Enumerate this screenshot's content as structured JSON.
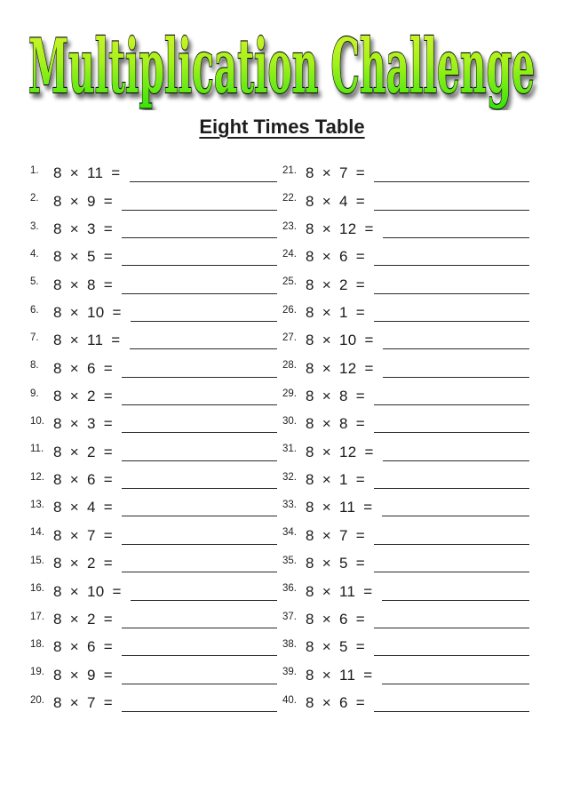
{
  "worksheet": {
    "title": "Multiplication Challenge",
    "subtitle": "Eight Times Table",
    "colors": {
      "title_fill_top": "#7cf020",
      "title_fill_mid": "#c8f52a",
      "title_fill_bottom": "#3fe60a",
      "title_outline": "#111111"
    },
    "left_column": [
      {
        "number": "1.",
        "expression": "8 × 11 ="
      },
      {
        "number": "2.",
        "expression": "8 × 9 ="
      },
      {
        "number": "3.",
        "expression": "8 × 3 ="
      },
      {
        "number": "4.",
        "expression": "8 × 5 ="
      },
      {
        "number": "5.",
        "expression": "8 × 8 ="
      },
      {
        "number": "6.",
        "expression": "8 × 10 ="
      },
      {
        "number": "7.",
        "expression": "8 × 11 ="
      },
      {
        "number": "8.",
        "expression": "8 × 6 ="
      },
      {
        "number": "9.",
        "expression": "8 × 2 ="
      },
      {
        "number": "10.",
        "expression": "8 × 3 ="
      },
      {
        "number": "11.",
        "expression": "8 × 2 ="
      },
      {
        "number": "12.",
        "expression": "8 × 6 ="
      },
      {
        "number": "13.",
        "expression": "8 × 4 ="
      },
      {
        "number": "14.",
        "expression": "8 × 7 ="
      },
      {
        "number": "15.",
        "expression": "8 × 2 ="
      },
      {
        "number": "16.",
        "expression": "8 × 10 ="
      },
      {
        "number": "17.",
        "expression": "8 × 2 ="
      },
      {
        "number": "18.",
        "expression": "8 × 6 ="
      },
      {
        "number": "19.",
        "expression": "8 × 9 ="
      },
      {
        "number": "20.",
        "expression": "8 × 7 ="
      }
    ],
    "right_column": [
      {
        "number": "21.",
        "expression": "8 × 7 ="
      },
      {
        "number": "22.",
        "expression": "8 × 4 ="
      },
      {
        "number": "23.",
        "expression": "8 × 12 ="
      },
      {
        "number": "24.",
        "expression": "8 × 6 ="
      },
      {
        "number": "25.",
        "expression": "8 × 2 ="
      },
      {
        "number": "26.",
        "expression": "8 × 1 ="
      },
      {
        "number": "27.",
        "expression": "8 × 10 ="
      },
      {
        "number": "28.",
        "expression": "8 × 12 ="
      },
      {
        "number": "29.",
        "expression": "8 × 8 ="
      },
      {
        "number": "30.",
        "expression": "8 × 8 ="
      },
      {
        "number": "31.",
        "expression": "8 × 12 ="
      },
      {
        "number": "32.",
        "expression": "8 × 1 ="
      },
      {
        "number": "33.",
        "expression": "8 × 11 ="
      },
      {
        "number": "34.",
        "expression": "8 × 7 ="
      },
      {
        "number": "35.",
        "expression": "8 × 5 ="
      },
      {
        "number": "36.",
        "expression": "8 × 11 ="
      },
      {
        "number": "37.",
        "expression": "8 × 6 ="
      },
      {
        "number": "38.",
        "expression": "8 × 5 ="
      },
      {
        "number": "39.",
        "expression": "8 × 11 ="
      },
      {
        "number": "40.",
        "expression": "8 × 6 ="
      }
    ]
  }
}
